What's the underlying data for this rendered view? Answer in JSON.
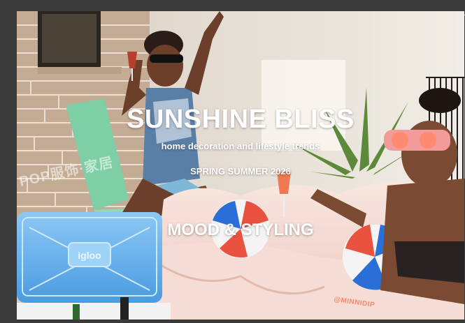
{
  "slide": {
    "title": "SUNSHINE BLISS",
    "subtitle": "home decoration and lifestyle trends",
    "season": "SPRING SUMMER 2026",
    "section_title": "MOOD & STYLING"
  },
  "photo": {
    "watermark": "POP服饰·家居",
    "cooler_brand": "igloo",
    "credit": "@MINNIDIP"
  },
  "colors": {
    "background": "#3a3a3a",
    "brick": "#c9b6a0",
    "pool": "#f3dcd4",
    "cooler": "#6fb4ee",
    "chair": "#7fcfa6",
    "credit": "#f08a6a"
  }
}
